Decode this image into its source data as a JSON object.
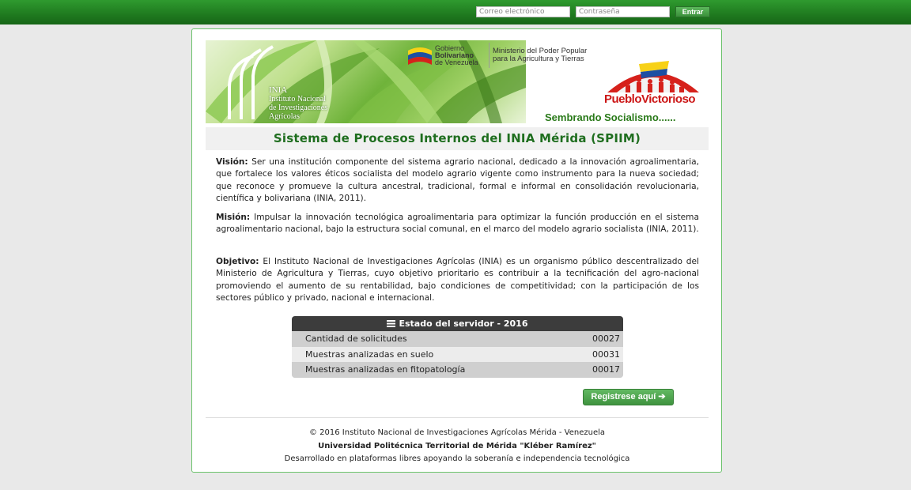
{
  "login": {
    "email_placeholder": "Correo electrónico",
    "password_placeholder": "Contraseña",
    "submit_label": "Entrar"
  },
  "banner": {
    "inia_abbr": "INIA",
    "inia_name_line1": "Instituto Nacional",
    "inia_name_line2": "de Investigaciones",
    "inia_name_line3": "Agrícolas",
    "gov_line1": "Gobierno",
    "gov_line2": "Bolivariano",
    "gov_line3": "de Venezuela",
    "ministry_line1": "Ministerio del Poder Popular",
    "ministry_line2": "para la Agricultura y Tierras",
    "pueblo_victorioso": "PuebloVictorioso",
    "slogan": "Sembrando Socialismo......"
  },
  "page_title": "Sistema de Procesos Internos del INIA Mérida (SPIIM)",
  "vision": {
    "label": "Visión:",
    "text": "Ser una institución componente del sistema agrario nacional, dedicado a la innovación agroalimentaria, que fortalece los valores éticos socialista del modelo agrario vigente como instrumento para la nueva sociedad; que reconoce y promueve la cultura ancestral, tradicional, formal e informal en consolidación revolucionaria, científica y bolivariana (INIA, 2011)."
  },
  "mision": {
    "label": "Misión:",
    "text": "Impulsar la innovación tecnológica agroalimentaria para optimizar la función producción en el sistema agroalimentario nacional, bajo la estructura social comunal, en el marco del modelo agrario socialista (INIA, 2011)."
  },
  "objetivo": {
    "label": "Objetivo:",
    "text": "El Instituto Nacional de Investigaciones Agrícolas (INIA) es un organismo público descentralizado del Ministerio de Agricultura y Tierras, cuyo objetivo prioritario es contribuir a la tecnificación del agro-nacional promoviendo el aumento de su rentabilidad, bajo condiciones de competitividad; con la participación de los sectores público y privado, nacional e internacional."
  },
  "server_status": {
    "title": "Estado del servidor - 2016",
    "rows": [
      {
        "label": "Cantidad de solicitudes",
        "value": "00027"
      },
      {
        "label": "Muestras analizadas en suelo",
        "value": "00031"
      },
      {
        "label": "Muestras analizadas en fitopatología",
        "value": "00017"
      }
    ]
  },
  "register_label": "Registrese aquí ➔",
  "footer": {
    "line1": "© 2016 Instituto Nacional de Investigaciones Agrícolas Mérida - Venezuela",
    "line2": "Universidad Politécnica Territorial de Mérida \"Kléber Ramírez\"",
    "line3": "Desarrollado en plataformas libres apoyando la soberanía e independencia tecnológica"
  },
  "colors": {
    "topbar": "#1f7a1f",
    "accent_green": "#1f6e1f",
    "button_green": "#3f933f",
    "table_header": "#3c3c3c",
    "brand_red": "#cc1616"
  }
}
